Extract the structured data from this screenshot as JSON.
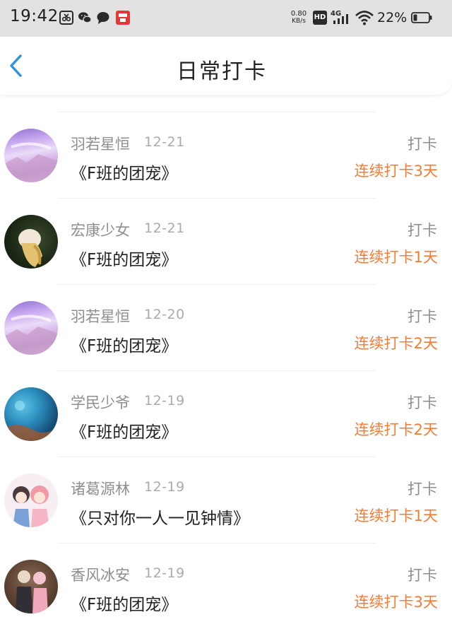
{
  "status_bar": {
    "time": "19:42",
    "net_speed": "0.80",
    "net_unit": "KB/s",
    "hd": "HD",
    "network_type": "4G",
    "battery": "22%",
    "icons": [
      "screen-capture-icon",
      "wechat-icon",
      "message-icon",
      "app-notification-icon"
    ]
  },
  "header": {
    "title": "日常打卡",
    "back_icon": "chevron-left-icon",
    "accent_color": "#2f8fe0"
  },
  "colors": {
    "streak": "#f57c35",
    "secondary_text": "#8e8e8e"
  },
  "entries": [
    {
      "name": "羽若星恒",
      "date": "12-21",
      "book": "《F班的团宠》",
      "action": "打卡",
      "streak": "连续打卡3天"
    },
    {
      "name": "宏康少女",
      "date": "12-21",
      "book": "《F班的团宠》",
      "action": "打卡",
      "streak": "连续打卡1天"
    },
    {
      "name": "羽若星恒",
      "date": "12-20",
      "book": "《F班的团宠》",
      "action": "打卡",
      "streak": "连续打卡2天"
    },
    {
      "name": "学民少爷",
      "date": "12-19",
      "book": "《F班的团宠》",
      "action": "打卡",
      "streak": "连续打卡2天"
    },
    {
      "name": "诸葛源林",
      "date": "12-19",
      "book": "《只对你一人一见钟情》",
      "action": "打卡",
      "streak": "连续打卡1天"
    },
    {
      "name": "香风冰安",
      "date": "12-19",
      "book": "《F班的团宠》",
      "action": "打卡",
      "streak": "连续打卡3天"
    }
  ]
}
